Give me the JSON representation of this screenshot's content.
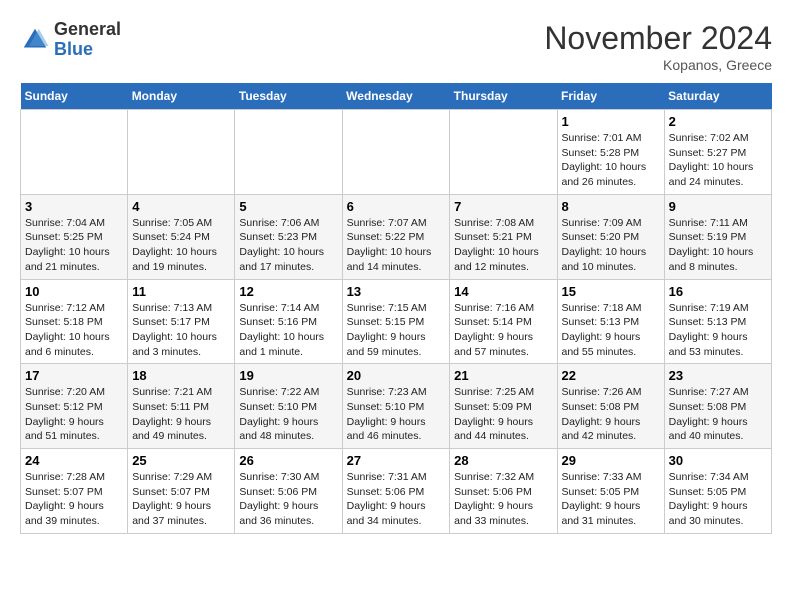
{
  "header": {
    "logo_general": "General",
    "logo_blue": "Blue",
    "month_title": "November 2024",
    "location": "Kopanos, Greece"
  },
  "weekdays": [
    "Sunday",
    "Monday",
    "Tuesday",
    "Wednesday",
    "Thursday",
    "Friday",
    "Saturday"
  ],
  "weeks": [
    [
      {
        "day": "",
        "info": ""
      },
      {
        "day": "",
        "info": ""
      },
      {
        "day": "",
        "info": ""
      },
      {
        "day": "",
        "info": ""
      },
      {
        "day": "",
        "info": ""
      },
      {
        "day": "1",
        "info": "Sunrise: 7:01 AM\nSunset: 5:28 PM\nDaylight: 10 hours\nand 26 minutes."
      },
      {
        "day": "2",
        "info": "Sunrise: 7:02 AM\nSunset: 5:27 PM\nDaylight: 10 hours\nand 24 minutes."
      }
    ],
    [
      {
        "day": "3",
        "info": "Sunrise: 7:04 AM\nSunset: 5:25 PM\nDaylight: 10 hours\nand 21 minutes."
      },
      {
        "day": "4",
        "info": "Sunrise: 7:05 AM\nSunset: 5:24 PM\nDaylight: 10 hours\nand 19 minutes."
      },
      {
        "day": "5",
        "info": "Sunrise: 7:06 AM\nSunset: 5:23 PM\nDaylight: 10 hours\nand 17 minutes."
      },
      {
        "day": "6",
        "info": "Sunrise: 7:07 AM\nSunset: 5:22 PM\nDaylight: 10 hours\nand 14 minutes."
      },
      {
        "day": "7",
        "info": "Sunrise: 7:08 AM\nSunset: 5:21 PM\nDaylight: 10 hours\nand 12 minutes."
      },
      {
        "day": "8",
        "info": "Sunrise: 7:09 AM\nSunset: 5:20 PM\nDaylight: 10 hours\nand 10 minutes."
      },
      {
        "day": "9",
        "info": "Sunrise: 7:11 AM\nSunset: 5:19 PM\nDaylight: 10 hours\nand 8 minutes."
      }
    ],
    [
      {
        "day": "10",
        "info": "Sunrise: 7:12 AM\nSunset: 5:18 PM\nDaylight: 10 hours\nand 6 minutes."
      },
      {
        "day": "11",
        "info": "Sunrise: 7:13 AM\nSunset: 5:17 PM\nDaylight: 10 hours\nand 3 minutes."
      },
      {
        "day": "12",
        "info": "Sunrise: 7:14 AM\nSunset: 5:16 PM\nDaylight: 10 hours\nand 1 minute."
      },
      {
        "day": "13",
        "info": "Sunrise: 7:15 AM\nSunset: 5:15 PM\nDaylight: 9 hours\nand 59 minutes."
      },
      {
        "day": "14",
        "info": "Sunrise: 7:16 AM\nSunset: 5:14 PM\nDaylight: 9 hours\nand 57 minutes."
      },
      {
        "day": "15",
        "info": "Sunrise: 7:18 AM\nSunset: 5:13 PM\nDaylight: 9 hours\nand 55 minutes."
      },
      {
        "day": "16",
        "info": "Sunrise: 7:19 AM\nSunset: 5:13 PM\nDaylight: 9 hours\nand 53 minutes."
      }
    ],
    [
      {
        "day": "17",
        "info": "Sunrise: 7:20 AM\nSunset: 5:12 PM\nDaylight: 9 hours\nand 51 minutes."
      },
      {
        "day": "18",
        "info": "Sunrise: 7:21 AM\nSunset: 5:11 PM\nDaylight: 9 hours\nand 49 minutes."
      },
      {
        "day": "19",
        "info": "Sunrise: 7:22 AM\nSunset: 5:10 PM\nDaylight: 9 hours\nand 48 minutes."
      },
      {
        "day": "20",
        "info": "Sunrise: 7:23 AM\nSunset: 5:10 PM\nDaylight: 9 hours\nand 46 minutes."
      },
      {
        "day": "21",
        "info": "Sunrise: 7:25 AM\nSunset: 5:09 PM\nDaylight: 9 hours\nand 44 minutes."
      },
      {
        "day": "22",
        "info": "Sunrise: 7:26 AM\nSunset: 5:08 PM\nDaylight: 9 hours\nand 42 minutes."
      },
      {
        "day": "23",
        "info": "Sunrise: 7:27 AM\nSunset: 5:08 PM\nDaylight: 9 hours\nand 40 minutes."
      }
    ],
    [
      {
        "day": "24",
        "info": "Sunrise: 7:28 AM\nSunset: 5:07 PM\nDaylight: 9 hours\nand 39 minutes."
      },
      {
        "day": "25",
        "info": "Sunrise: 7:29 AM\nSunset: 5:07 PM\nDaylight: 9 hours\nand 37 minutes."
      },
      {
        "day": "26",
        "info": "Sunrise: 7:30 AM\nSunset: 5:06 PM\nDaylight: 9 hours\nand 36 minutes."
      },
      {
        "day": "27",
        "info": "Sunrise: 7:31 AM\nSunset: 5:06 PM\nDaylight: 9 hours\nand 34 minutes."
      },
      {
        "day": "28",
        "info": "Sunrise: 7:32 AM\nSunset: 5:06 PM\nDaylight: 9 hours\nand 33 minutes."
      },
      {
        "day": "29",
        "info": "Sunrise: 7:33 AM\nSunset: 5:05 PM\nDaylight: 9 hours\nand 31 minutes."
      },
      {
        "day": "30",
        "info": "Sunrise: 7:34 AM\nSunset: 5:05 PM\nDaylight: 9 hours\nand 30 minutes."
      }
    ]
  ]
}
